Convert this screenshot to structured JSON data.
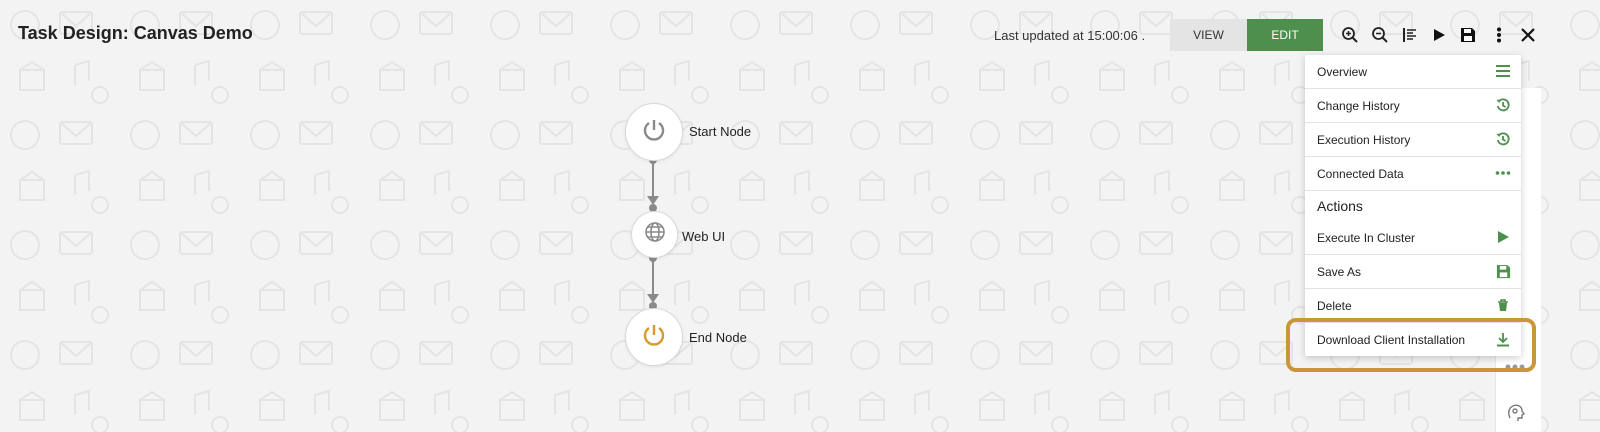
{
  "header": {
    "title": "Task Design: Canvas Demo",
    "last_updated": "Last updated at 15:00:06 .",
    "view_label": "VIEW",
    "edit_label": "EDIT"
  },
  "toolbar": {
    "icons": [
      "zoom-in-icon",
      "zoom-out-icon",
      "align-icon",
      "run-icon",
      "save-icon",
      "more-icon",
      "close-icon"
    ]
  },
  "canvas": {
    "nodes": [
      {
        "label": "Start Node",
        "icon": "power-icon",
        "color": "#8a8a8a"
      },
      {
        "label": "Web UI",
        "icon": "globe-icon",
        "color": "#8a8a8a"
      },
      {
        "label": "End Node",
        "icon": "power-icon",
        "color": "#d79a2b"
      }
    ]
  },
  "menu": {
    "items": [
      {
        "label": "Overview",
        "icon": "list-icon"
      },
      {
        "label": "Change History",
        "icon": "history-icon"
      },
      {
        "label": "Execution History",
        "icon": "history-icon"
      },
      {
        "label": "Connected Data",
        "icon": "ellipsis-icon"
      }
    ],
    "actions_heading": "Actions",
    "actions": [
      {
        "label": "Execute In Cluster",
        "icon": "play-icon"
      },
      {
        "label": "Save As",
        "icon": "save-icon"
      },
      {
        "label": "Delete",
        "icon": "trash-icon"
      },
      {
        "label": "Download Client Installation",
        "icon": "download-icon"
      }
    ]
  },
  "colors": {
    "accent": "#4d8f4d",
    "highlight": "#c9963a",
    "end_node": "#d79a2b"
  }
}
